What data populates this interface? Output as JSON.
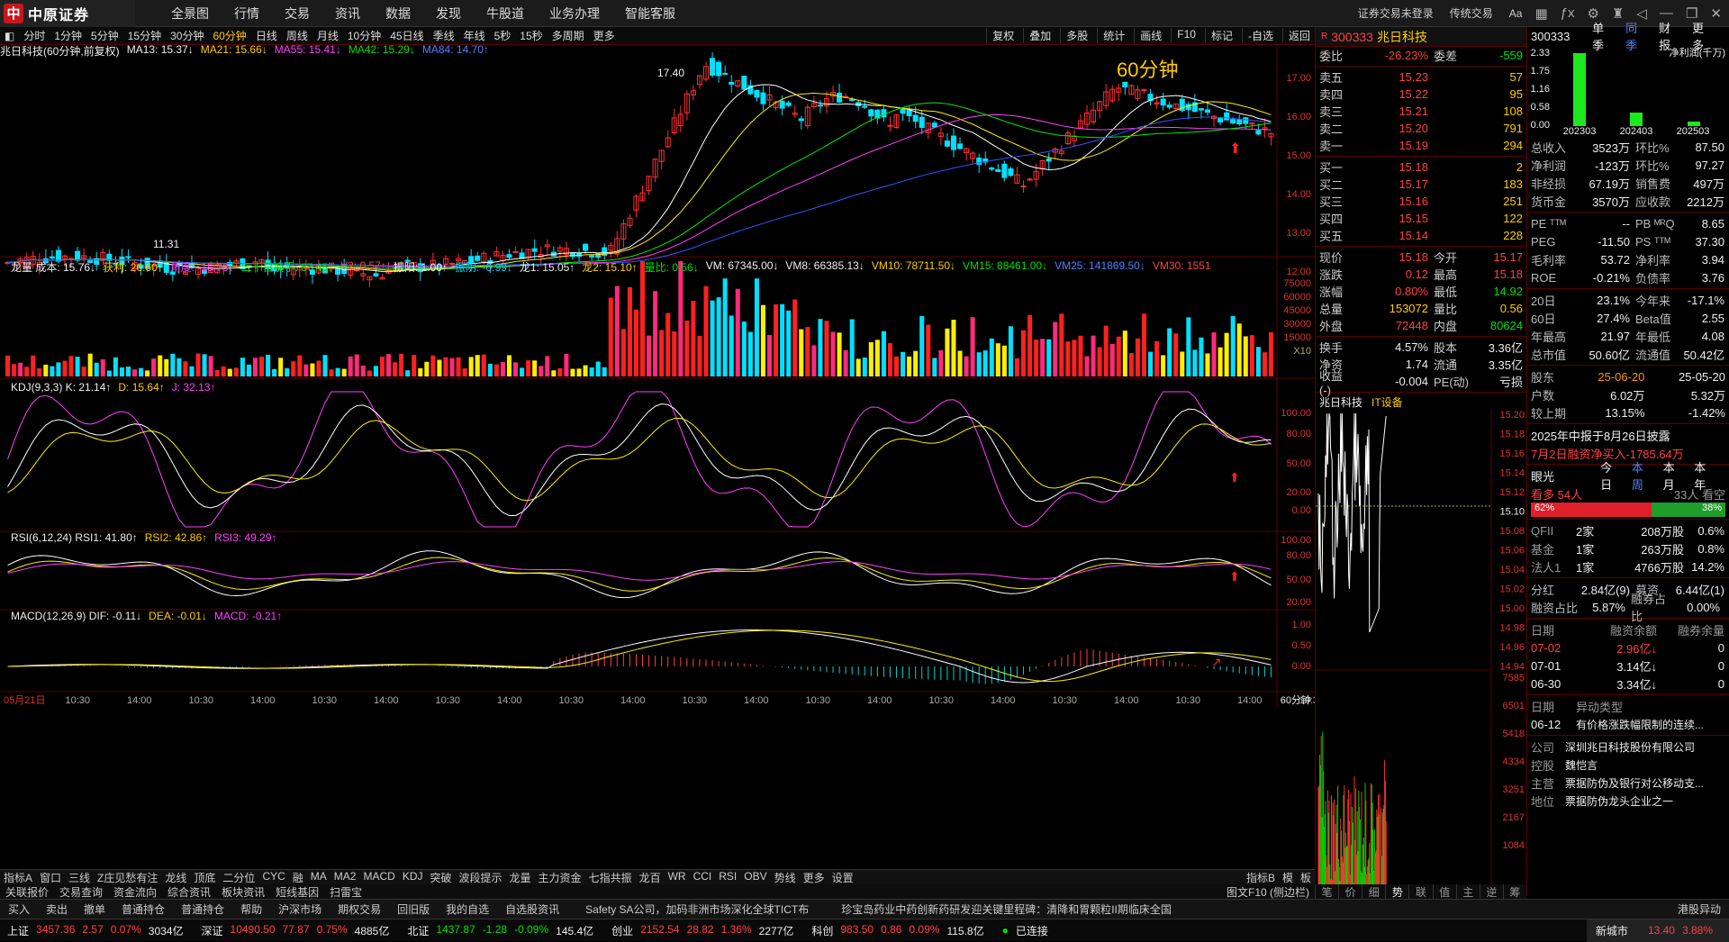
{
  "app": {
    "brand": "中原证券",
    "menu": [
      "全景图",
      "行情",
      "交易",
      "资讯",
      "数据",
      "发现",
      "牛股道",
      "业务办理",
      "智能客服"
    ],
    "right": [
      "证券交易未登录",
      "传统交易",
      "Aa"
    ]
  },
  "periods": [
    "分时",
    "1分钟",
    "5分钟",
    "15分钟",
    "30分钟",
    "60分钟",
    "日线",
    "周线",
    "月线",
    "10分钟",
    "45日线",
    "季线",
    "年线",
    "5秒",
    "15秒",
    "多周期",
    "更多"
  ],
  "active_period": "60分钟",
  "tools": [
    "复权",
    "叠加",
    "多股",
    "统计",
    "画线",
    "F10",
    "标记",
    "-自选",
    "返回"
  ],
  "main_legend": {
    "title": "兆日科技(60分钟,前复权)",
    "items": [
      {
        "t": "MA13: 15.37↓",
        "c": "wht"
      },
      {
        "t": "MA21: 15.66↓",
        "c": "yel"
      },
      {
        "t": "MA55: 15.41↓",
        "c": "mag"
      },
      {
        "t": "MA42: 15.29↓",
        "c": "green"
      },
      {
        "t": "MA84: 14.70↑",
        "c": "blu"
      }
    ]
  },
  "main_annot": {
    "period_label": "60分钟",
    "high": "17.40",
    "low": "11.31"
  },
  "price_axis": [
    "17.00",
    "16.00",
    "15.00",
    "14.00",
    "13.00",
    "12.00"
  ],
  "vol_legend": [
    {
      "t": "龙量 成本: 15.76↓",
      "c": "wht"
    },
    {
      "t": "获利: 26.60↑",
      "c": "yel"
    },
    {
      "t": "角度: -15.76↓",
      "c": "mag"
    },
    {
      "t": "二十日换手: 67.45↓",
      "c": "green"
    },
    {
      "t": "V2: 0.57↑",
      "c": "red"
    },
    {
      "t": "振阳: 1.00↑",
      "c": "wht"
    },
    {
      "t": "振阴: -0.99↓",
      "c": "cyn"
    },
    {
      "t": "龙1: 15.05↑",
      "c": "wht"
    },
    {
      "t": "龙2: 15.10↑",
      "c": "yel"
    },
    {
      "t": "量比: 0.56↓",
      "c": "green"
    },
    {
      "t": "VM: 67345.00↓",
      "c": "wht"
    },
    {
      "t": "VM8: 66385.13↓",
      "c": "wht"
    },
    {
      "t": "VM10: 78711.50↓",
      "c": "yel"
    },
    {
      "t": "VM15: 88461.00↓",
      "c": "green"
    },
    {
      "t": "VM25: 141869.50↓",
      "c": "blu"
    },
    {
      "t": "VM30: 1551",
      "c": "red"
    }
  ],
  "vol_axis": [
    "75000",
    "60000",
    "45000",
    "30000",
    "15000",
    "X10"
  ],
  "kdj_legend": [
    {
      "t": "KDJ(9,3,3) K: 21.14↑",
      "c": "wht"
    },
    {
      "t": "D: 15.64↑",
      "c": "yel"
    },
    {
      "t": "J: 32.13↑",
      "c": "mag"
    }
  ],
  "kdj_axis": [
    "100.00",
    "80.00",
    "50.00",
    "20.00",
    "0.00"
  ],
  "rsi_legend": [
    {
      "t": "RSI(6,12,24) RSI1: 41.80↑",
      "c": "wht"
    },
    {
      "t": "RSI2: 42.86↑",
      "c": "yel"
    },
    {
      "t": "RSI3: 49.29↑",
      "c": "mag"
    }
  ],
  "rsi_axis": [
    "100.00",
    "80.00",
    "50.00",
    "20.00"
  ],
  "macd_legend": [
    {
      "t": "MACD(12,26,9) DIF: -0.11↓",
      "c": "wht"
    },
    {
      "t": "DEA: -0.01↓",
      "c": "yel"
    },
    {
      "t": "MACD: -0.21↑",
      "c": "mag"
    }
  ],
  "macd_axis": [
    "1.00",
    "0.50",
    "0.00"
  ],
  "time_axis": [
    "05月21日",
    "10:30",
    "14:00",
    "10:30",
    "14:00",
    "10:30",
    "14:00",
    "10:30",
    "14:00",
    "10:30",
    "14:00",
    "10:30",
    "14:00",
    "10:30",
    "14:00",
    "10:30",
    "14:00",
    "10:30",
    "14:00",
    "10:30",
    "14:00",
    "10:30"
  ],
  "time_period": "60分钟",
  "quote": {
    "code": "300333",
    "name": "兆日科技",
    "webi": {
      "k": "委比",
      "v": "-26.23%",
      "k2": "委差",
      "v2": "-559"
    },
    "asks": [
      {
        "k": "卖五",
        "p": "15.23",
        "q": "57"
      },
      {
        "k": "卖四",
        "p": "15.22",
        "q": "95"
      },
      {
        "k": "卖三",
        "p": "15.21",
        "q": "108"
      },
      {
        "k": "卖二",
        "p": "15.20",
        "q": "791"
      },
      {
        "k": "卖一",
        "p": "15.19",
        "q": "294"
      }
    ],
    "bids": [
      {
        "k": "买一",
        "p": "15.18",
        "q": "2"
      },
      {
        "k": "买二",
        "p": "15.17",
        "q": "183"
      },
      {
        "k": "买三",
        "p": "15.16",
        "q": "251"
      },
      {
        "k": "买四",
        "p": "15.15",
        "q": "122"
      },
      {
        "k": "买五",
        "p": "15.14",
        "q": "228"
      }
    ],
    "stats": [
      {
        "k": "现价",
        "v": "15.18",
        "k2": "今开",
        "v2": "15.17"
      },
      {
        "k": "涨跌",
        "v": "0.12",
        "k2": "最高",
        "v2": "15.18"
      },
      {
        "k": "涨幅",
        "v": "0.80%",
        "k2": "最低",
        "v2": "14.92"
      },
      {
        "k": "总量",
        "v": "153072",
        "k2": "量比",
        "v2": "0.56"
      },
      {
        "k": "外盘",
        "v": "72448",
        "k2": "内盘",
        "v2": "80624"
      }
    ],
    "stats2": [
      {
        "k": "换手",
        "v": "4.57%",
        "k2": "股本",
        "v2": "3.36亿"
      },
      {
        "k": "净资",
        "v": "1.74",
        "k2": "流通",
        "v2": "3.35亿"
      },
      {
        "k": "收益(-)",
        "v": "-0.004",
        "k2": "PE(动)",
        "v2": "亏损"
      }
    ],
    "mini_title": "兆日科技",
    "mini_tag": "IT设备",
    "mini_axis": [
      "15.20",
      "15.18",
      "15.16",
      "15.14",
      "15.12",
      "15.10",
      "15.08",
      "15.06",
      "15.04",
      "15.02",
      "15.00",
      "14.98",
      "14.96",
      "14.94",
      "7585",
      "6501",
      "5418",
      "4334",
      "3251",
      "2167",
      "1084"
    ]
  },
  "fin": {
    "code": "300333",
    "tabs": [
      "单季",
      "同季",
      "财报",
      "更多"
    ],
    "chart_title": "净利润(千万)",
    "bar_y": [
      "2.33",
      "1.75",
      "1.16",
      "0.58",
      "0.00"
    ],
    "bar_x": [
      "202303",
      "202403",
      "202503"
    ],
    "rows1": [
      {
        "k": "总收入",
        "v": "3523万",
        "k2": "环比%",
        "v2": "87.50"
      },
      {
        "k": "净利润",
        "v": "-123万",
        "k2": "环比%",
        "v2": "97.27"
      },
      {
        "k": "非经损",
        "v": "67.19万",
        "k2": "销售费",
        "v2": "497万"
      },
      {
        "k": "货币金",
        "v": "3570万",
        "k2": "应收款",
        "v2": "2212万"
      }
    ],
    "rows2": [
      {
        "k": "PE ᵀᵀᴹ",
        "v": "--",
        "k2": "PB ᴹᴿQ",
        "v2": "8.65"
      },
      {
        "k": "PEG",
        "v": "-11.50",
        "k2": "PS ᵀᵀᴹ",
        "v2": "37.30"
      },
      {
        "k": "毛利率",
        "v": "53.72",
        "k2": "净利率",
        "v2": "3.94"
      },
      {
        "k": "ROE",
        "v": "-0.21%",
        "k2": "负债率",
        "v2": "3.76"
      }
    ],
    "rows3": [
      {
        "k": "20日",
        "v": "23.1%",
        "k2": "今年来",
        "v2": "-17.1%"
      },
      {
        "k": "60日",
        "v": "27.4%",
        "k2": "Beta值",
        "v2": "2.55"
      },
      {
        "k": "年最高",
        "v": "21.97",
        "k2": "年最低",
        "v2": "4.08"
      },
      {
        "k": "总市值",
        "v": "50.60亿",
        "k2": "流通值",
        "v2": "50.42亿"
      }
    ],
    "holders": [
      {
        "k": "股东",
        "v": "25-06-20",
        "v2": "25-05-20"
      },
      {
        "k": "户数",
        "v": "6.02万",
        "v2": "5.32万"
      },
      {
        "k": "较上期",
        "v": "13.15%",
        "v2": "-1.42%"
      }
    ],
    "notice1": "2025年中报于8月26日披露",
    "notice2": "7月2日融资净买入-1785.64万",
    "eye": {
      "label": "眼光",
      "tabs": [
        "今日",
        "本周",
        "本月",
        "本年"
      ],
      "bull": "看多 54人",
      "bear": "33人 看空",
      "pct_bull": "62%",
      "pct_bear": "38%"
    },
    "inst": [
      {
        "k": "QFII",
        "a": "2家",
        "b": "208万股",
        "c": "0.6%"
      },
      {
        "k": "基金",
        "a": "1家",
        "b": "263万股",
        "c": "0.8%"
      },
      {
        "k": "法人1",
        "a": "1家",
        "b": "4766万股",
        "c": "14.2%"
      }
    ],
    "div": {
      "k": "分红",
      "v": "2.84亿(9)",
      "k2": "募资",
      "v2": "6.44亿(1)"
    },
    "margin": {
      "k": "融资占比",
      "v": "5.87%",
      "k2": "融券占比",
      "v2": "0.00%"
    },
    "margin_hdr": [
      "日期",
      "融资余额",
      "融券余量"
    ],
    "margin_rows": [
      {
        "d": "07-02",
        "a": "2.96亿↓",
        "b": "0"
      },
      {
        "d": "07-01",
        "a": "3.14亿↓",
        "b": "0"
      },
      {
        "d": "06-30",
        "a": "3.34亿↓",
        "b": "0"
      }
    ],
    "abn_hdr": [
      "日期",
      "异动类型"
    ],
    "abn": {
      "d": "06-12",
      "t": "有价格涨跌幅限制的连续..."
    },
    "company": [
      {
        "k": "公司",
        "v": "深圳兆日科技股份有限公司"
      },
      {
        "k": "控股",
        "v": "魏恺言"
      },
      {
        "k": "主营",
        "v": "票据防伪及银行对公移动支..."
      },
      {
        "k": "地位",
        "v": "票据防伪龙头企业之一"
      }
    ]
  },
  "bottom1": [
    "指标A",
    "窗口",
    "三线",
    "Z庄见愁有注",
    "龙线",
    "顶底",
    "二分位",
    "CYC",
    "融",
    "MA",
    "MA2",
    "MACD",
    "KDJ",
    "突破",
    "波段提示",
    "龙量",
    "主力资金",
    "七指共振",
    "龙百",
    "WR",
    "CCI",
    "RSI",
    "OBV",
    "势线",
    "更多",
    "设置"
  ],
  "bottom1_right": [
    "指标B",
    "模",
    "板"
  ],
  "bottom2": [
    "关联报价",
    "交易查询",
    "资金流向",
    "综合资讯",
    "板块资讯",
    "短线基因",
    "扫雷宝"
  ],
  "bottom2_right": "图文F10 (侧边栏)",
  "qtabs": [
    "笔",
    "价",
    "细",
    "势",
    "联",
    "值",
    "主",
    "逆",
    "筹"
  ],
  "bottom3": [
    "买入",
    "卖出",
    "撤单",
    "普通持仓",
    "普通持仓",
    "帮助",
    "沪深市场",
    "期权交易",
    "回旧版",
    "我的自选",
    "自选股资讯"
  ],
  "news": "Safety SA公司，加码非洲市场深化全球TICT布　　　珍宝岛药业中药创新药研发迎关键里程碑：清降和胃颗粒II期临床全国",
  "news_right": "港股异动",
  "index_bar": [
    {
      "n": "上证",
      "v": "3457.36",
      "c": "2.57",
      "p": "0.07%",
      "a": "3034亿"
    },
    {
      "n": "深证",
      "v": "10490.50",
      "c": "77.87",
      "p": "0.75%",
      "a": "4885亿"
    },
    {
      "n": "北证",
      "v": "1437.87",
      "c": "-1.28",
      "p": "-0.09%",
      "a": "145.4亿"
    },
    {
      "n": "创业",
      "v": "2152.54",
      "c": "28.82",
      "p": "1.36%",
      "a": "2277亿"
    },
    {
      "n": "科创",
      "v": "983.50",
      "c": "0.86",
      "p": "0.09%",
      "a": "115.8亿"
    }
  ],
  "conn": "已连接",
  "ticker": {
    "n": "新城市",
    "v": "13.40",
    "p": "3.88%"
  }
}
